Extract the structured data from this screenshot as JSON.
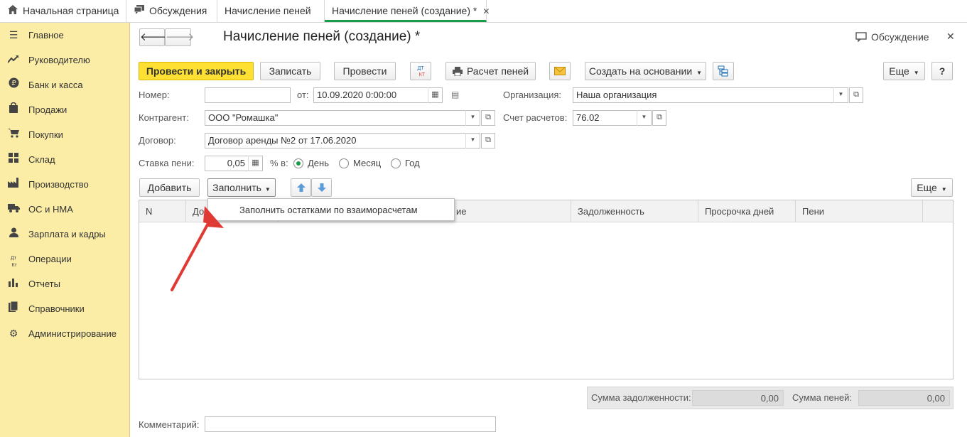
{
  "tabs": [
    {
      "label": "Начальная страница",
      "icon": "home-icon"
    },
    {
      "label": "Обсуждения",
      "icon": "chat-icon"
    },
    {
      "label": "Начисление пеней"
    },
    {
      "label": "Начисление пеней (создание) *",
      "active": true
    }
  ],
  "sidebar": {
    "items": [
      {
        "label": "Главное",
        "icon": "menu-icon"
      },
      {
        "label": "Руководителю",
        "icon": "trend-icon"
      },
      {
        "label": "Банк и касса",
        "icon": "ruble-icon"
      },
      {
        "label": "Продажи",
        "icon": "bag-icon"
      },
      {
        "label": "Покупки",
        "icon": "cart-icon"
      },
      {
        "label": "Склад",
        "icon": "grid-icon"
      },
      {
        "label": "Производство",
        "icon": "factory-icon"
      },
      {
        "label": "ОС и НМА",
        "icon": "truck-icon"
      },
      {
        "label": "Зарплата и кадры",
        "icon": "person-icon"
      },
      {
        "label": "Операции",
        "icon": "dtkt-icon"
      },
      {
        "label": "Отчеты",
        "icon": "bars-icon"
      },
      {
        "label": "Справочники",
        "icon": "book-icon"
      },
      {
        "label": "Администрирование",
        "icon": "gear-icon"
      }
    ]
  },
  "form": {
    "title": "Начисление пеней (создание) *",
    "discussion_label": "Обсуждение",
    "toolbar": {
      "post_close": "Провести и закрыть",
      "save": "Записать",
      "post": "Провести",
      "dtkt": "ДТ КТ",
      "calc": "Расчет пеней",
      "create_based": "Создать на основании",
      "more": "Еще",
      "help": "?"
    },
    "number_label": "Номер:",
    "number_value": "",
    "date_label": "от:",
    "date_value": "10.09.2020  0:00:00",
    "org_label": "Организация:",
    "org_value": "Наша организация",
    "counterparty_label": "Контрагент:",
    "counterparty_value": "ООО \"Ромашка\"",
    "account_label": "Счет расчетов:",
    "account_value": "76.02",
    "contract_label": "Договор:",
    "contract_value": "Договор аренды №2 от 17.06.2020",
    "rate_label": "Ставка пени:",
    "rate_value": "0,05",
    "percent_label": "% в:",
    "period_options": [
      {
        "label": "День",
        "selected": true
      },
      {
        "label": "Месяц",
        "selected": false
      },
      {
        "label": "Год",
        "selected": false
      }
    ],
    "table_toolbar": {
      "add": "Добавить",
      "fill": "Заполнить",
      "more": "Еще"
    },
    "fill_menu": {
      "items": [
        "Заполнить остатками по взаиморасчетам"
      ]
    },
    "table": {
      "columns": [
        "N",
        "До",
        "ие",
        "Задолженность",
        "Просрочка дней",
        "Пени"
      ],
      "rows": []
    },
    "totals": {
      "debt_label": "Сумма задолженности:",
      "debt_value": "0,00",
      "penalty_label": "Сумма пеней:",
      "penalty_value": "0,00"
    },
    "comment_label": "Комментарий:",
    "comment_value": ""
  },
  "colors": {
    "sidebar_bg": "#fbeca6",
    "primary_button": "#fde031",
    "active_tab_underline": "#1a9d4b",
    "annotation_arrow": "#e03a35"
  }
}
